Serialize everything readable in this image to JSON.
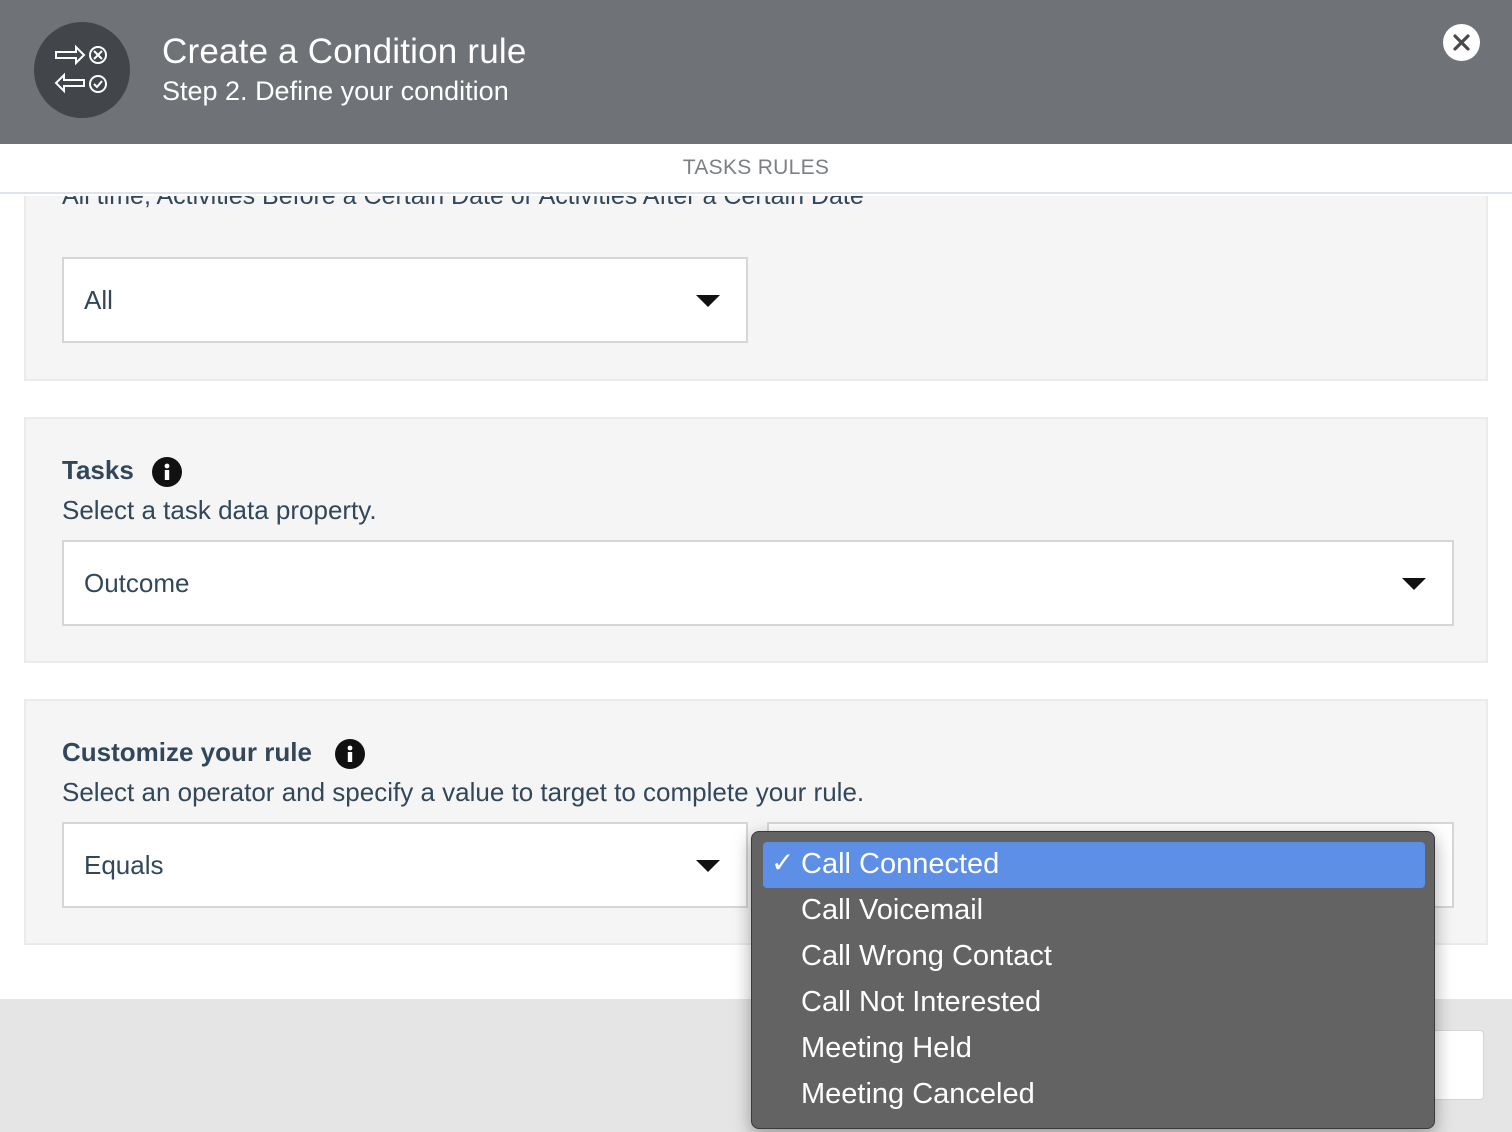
{
  "header": {
    "title": "Create a Condition rule",
    "subtitle": "Step 2. Define your condition",
    "badge_icon": "condition-rule-icon",
    "close_icon": "close-icon"
  },
  "tabs": {
    "active_label": "TASKS RULES"
  },
  "date_panel": {
    "partial_text": "All time, Activities Before a Certain Date or Activities After a Certain Date",
    "select_value": "All"
  },
  "tasks_panel": {
    "heading": "Tasks",
    "help": "Select a task data property.",
    "select_value": "Outcome"
  },
  "customize_panel": {
    "heading": "Customize your rule",
    "help": "Select an operator and specify a value to target to complete your rule.",
    "operator_value": "Equals"
  },
  "value_menu": {
    "check_glyph": "✓",
    "items": [
      {
        "label": "Call Connected",
        "selected": true
      },
      {
        "label": "Call Voicemail",
        "selected": false
      },
      {
        "label": "Call Wrong Contact",
        "selected": false
      },
      {
        "label": "Call Not Interested",
        "selected": false
      },
      {
        "label": "Meeting Held",
        "selected": false
      },
      {
        "label": "Meeting Canceled",
        "selected": false
      }
    ]
  },
  "colors": {
    "header_bg": "#6f7277",
    "badge_bg": "#424549",
    "menu_bg": "#636363",
    "menu_selected": "#5e8fe6",
    "text": "#33475b"
  }
}
